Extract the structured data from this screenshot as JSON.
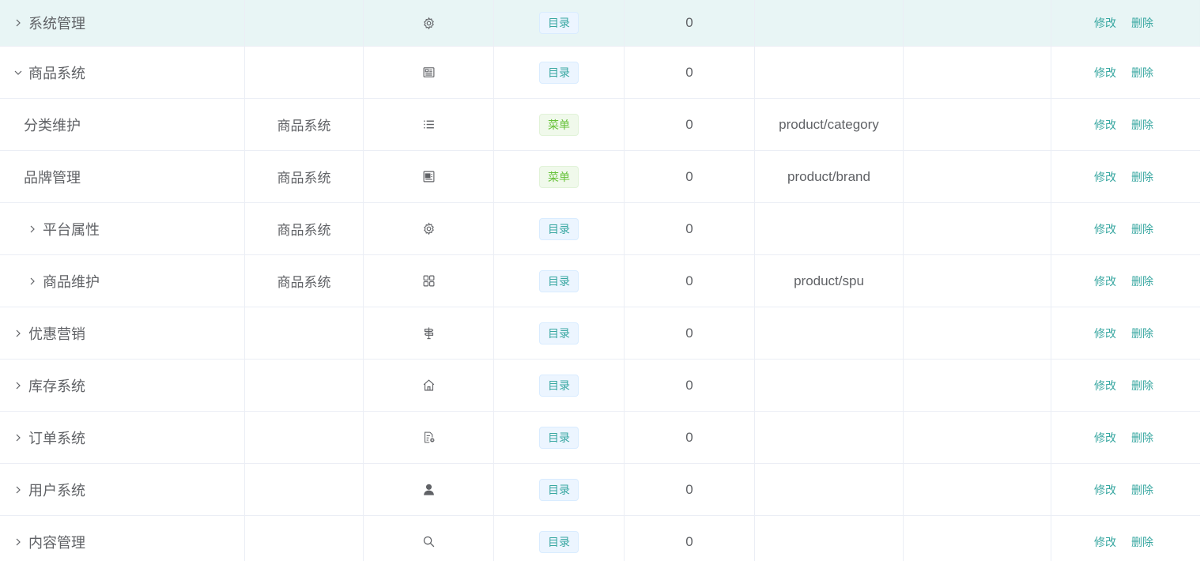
{
  "colors": {
    "highlight_row": "#e8f5f5",
    "link": "#38a7a1",
    "tag_directory_text": "#38a7a1",
    "tag_menu_text": "#67c23a",
    "border": "#ebeef5"
  },
  "rows": [
    {
      "name": "系统管理",
      "indent": 0,
      "toggle": "collapsed",
      "parent": "",
      "icon": "gear-icon",
      "type": "目录",
      "type_kind": "dir",
      "sort": "0",
      "url": "",
      "perm": "",
      "edit": "修改",
      "delete": "删除"
    },
    {
      "name": "商品系统",
      "indent": 0,
      "toggle": "expanded",
      "parent": "",
      "icon": "document-icon",
      "type": "目录",
      "type_kind": "dir",
      "sort": "0",
      "url": "",
      "perm": "",
      "edit": "修改",
      "delete": "删除"
    },
    {
      "name": "分类维护",
      "indent": 1,
      "toggle": "none",
      "parent": "商品系统",
      "icon": "list-icon",
      "type": "菜单",
      "type_kind": "menu",
      "sort": "0",
      "url": "product/category",
      "perm": "",
      "edit": "修改",
      "delete": "删除"
    },
    {
      "name": "品牌管理",
      "indent": 1,
      "toggle": "none",
      "parent": "商品系统",
      "icon": "card-icon",
      "type": "菜单",
      "type_kind": "menu",
      "sort": "0",
      "url": "product/brand",
      "perm": "",
      "edit": "修改",
      "delete": "删除"
    },
    {
      "name": "平台属性",
      "indent": 1,
      "toggle": "collapsed",
      "parent": "商品系统",
      "icon": "gear-icon",
      "type": "目录",
      "type_kind": "dir",
      "sort": "0",
      "url": "",
      "perm": "",
      "edit": "修改",
      "delete": "删除"
    },
    {
      "name": "商品维护",
      "indent": 1,
      "toggle": "collapsed",
      "parent": "商品系统",
      "icon": "grid-icon",
      "type": "目录",
      "type_kind": "dir",
      "sort": "0",
      "url": "product/spu",
      "perm": "",
      "edit": "修改",
      "delete": "删除"
    },
    {
      "name": "优惠营销",
      "indent": 0,
      "toggle": "collapsed",
      "parent": "",
      "icon": "signpost-icon",
      "type": "目录",
      "type_kind": "dir",
      "sort": "0",
      "url": "",
      "perm": "",
      "edit": "修改",
      "delete": "删除"
    },
    {
      "name": "库存系统",
      "indent": 0,
      "toggle": "collapsed",
      "parent": "",
      "icon": "home-icon",
      "type": "目录",
      "type_kind": "dir",
      "sort": "0",
      "url": "",
      "perm": "",
      "edit": "修改",
      "delete": "删除"
    },
    {
      "name": "订单系统",
      "indent": 0,
      "toggle": "collapsed",
      "parent": "",
      "icon": "order-settings-icon",
      "type": "目录",
      "type_kind": "dir",
      "sort": "0",
      "url": "",
      "perm": "",
      "edit": "修改",
      "delete": "删除"
    },
    {
      "name": "用户系统",
      "indent": 0,
      "toggle": "collapsed",
      "parent": "",
      "icon": "user-icon",
      "type": "目录",
      "type_kind": "dir",
      "sort": "0",
      "url": "",
      "perm": "",
      "edit": "修改",
      "delete": "删除"
    },
    {
      "name": "内容管理",
      "indent": 0,
      "toggle": "collapsed",
      "parent": "",
      "icon": "search-icon",
      "type": "目录",
      "type_kind": "dir",
      "sort": "0",
      "url": "",
      "perm": "",
      "edit": "修改",
      "delete": "删除"
    }
  ]
}
